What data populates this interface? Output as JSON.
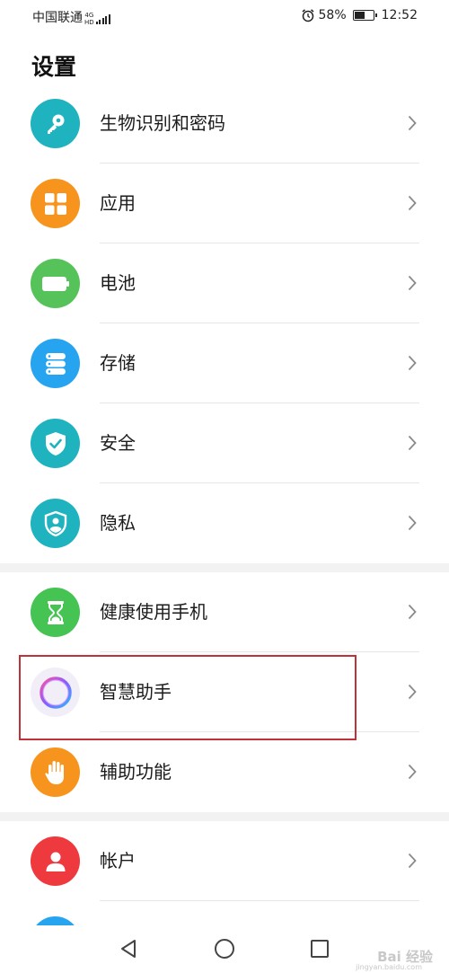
{
  "status_bar": {
    "carrier": "中国联通",
    "network_type": "4G",
    "network_sub": "HD",
    "battery_percent": "58%",
    "battery_level": 0.58,
    "time": "12:52"
  },
  "page": {
    "title": "设置"
  },
  "settings": {
    "group1": [
      {
        "label": "生物识别和密码",
        "icon": "key-icon",
        "color": "#1fb3bf"
      },
      {
        "label": "应用",
        "icon": "apps-grid-icon",
        "color": "#f7941d"
      },
      {
        "label": "电池",
        "icon": "battery-icon",
        "color": "#56c25a"
      },
      {
        "label": "存储",
        "icon": "storage-icon",
        "color": "#27a4f0"
      },
      {
        "label": "安全",
        "icon": "shield-check-icon",
        "color": "#1fb3bf"
      },
      {
        "label": "隐私",
        "icon": "privacy-shield-icon",
        "color": "#1fb3bf"
      }
    ],
    "group2": [
      {
        "label": "健康使用手机",
        "icon": "hourglass-icon",
        "color": "#45c353"
      },
      {
        "label": "智慧助手",
        "icon": "assistant-ring-icon",
        "color": "#f1eef7"
      },
      {
        "label": "辅助功能",
        "icon": "hand-icon",
        "color": "#f7941d"
      }
    ],
    "group3": [
      {
        "label": "帐户",
        "icon": "user-icon",
        "color": "#ee3a3f"
      }
    ]
  },
  "highlighted_item": "智慧助手",
  "nav_bar": {
    "back": "back-triangle-icon",
    "home": "home-circle-icon",
    "recent": "recents-square-icon"
  },
  "watermark": {
    "text": "Bai 经验",
    "sub": "jingyan.baidu.com"
  }
}
